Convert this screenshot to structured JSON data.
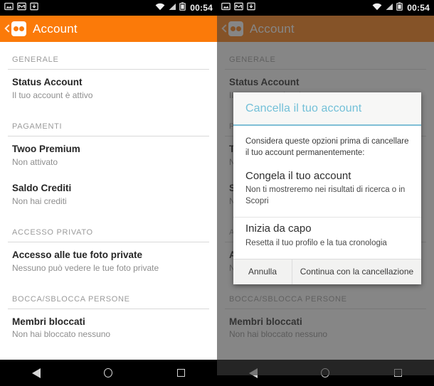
{
  "status_bar": {
    "notification_icons": [
      "image-icon",
      "gmail-icon",
      "download-icon"
    ],
    "wifi_icon": "wifi-icon",
    "signal_icon": "signal-icon",
    "battery_icon": "battery-icon",
    "time": "00:54"
  },
  "app_bar": {
    "back_label": "back-chevron-icon",
    "logo": "twoo-logo-icon",
    "title": "Account",
    "background_color": "#fb7a09"
  },
  "settings": {
    "sections": [
      {
        "label": "GENERALE",
        "rows": [
          {
            "title": "Status Account",
            "subtitle": "Il tuo account è attivo"
          }
        ]
      },
      {
        "label": "PAGAMENTI",
        "rows": [
          {
            "title": "Twoo Premium",
            "subtitle": "Non attivato"
          },
          {
            "title": "Saldo Crediti",
            "subtitle": "Non hai crediti"
          }
        ]
      },
      {
        "label": "ACCESSO PRIVATO",
        "rows": [
          {
            "title": "Accesso alle tue foto private",
            "subtitle": "Nessuno può vedere le tue foto private"
          }
        ]
      },
      {
        "label": "BOCCA/SBLOCCA PERSONE",
        "rows": [
          {
            "title": "Membri bloccati",
            "subtitle": "Non hai bloccato nessuno"
          }
        ]
      }
    ]
  },
  "dialog": {
    "title": "Cancella il tuo account",
    "title_color": "#73c0d8",
    "accent_color": "#7fbfd6",
    "intro": "Considera queste opzioni prima di cancellare il tuo account permanentemente:",
    "options": [
      {
        "title": "Congela il tuo account",
        "subtitle": "Non ti mostreremo nei risultati di ricerca o in Scopri"
      },
      {
        "title": "Inizia da capo",
        "subtitle": "Resetta il tuo profilo e la tua cronologia"
      }
    ],
    "cancel_label": "Annulla",
    "confirm_label": "Continua con la cancellazione"
  },
  "nav_bar": {
    "back": "back-triangle-icon",
    "home": "home-circle-icon",
    "recents": "recents-square-icon"
  }
}
